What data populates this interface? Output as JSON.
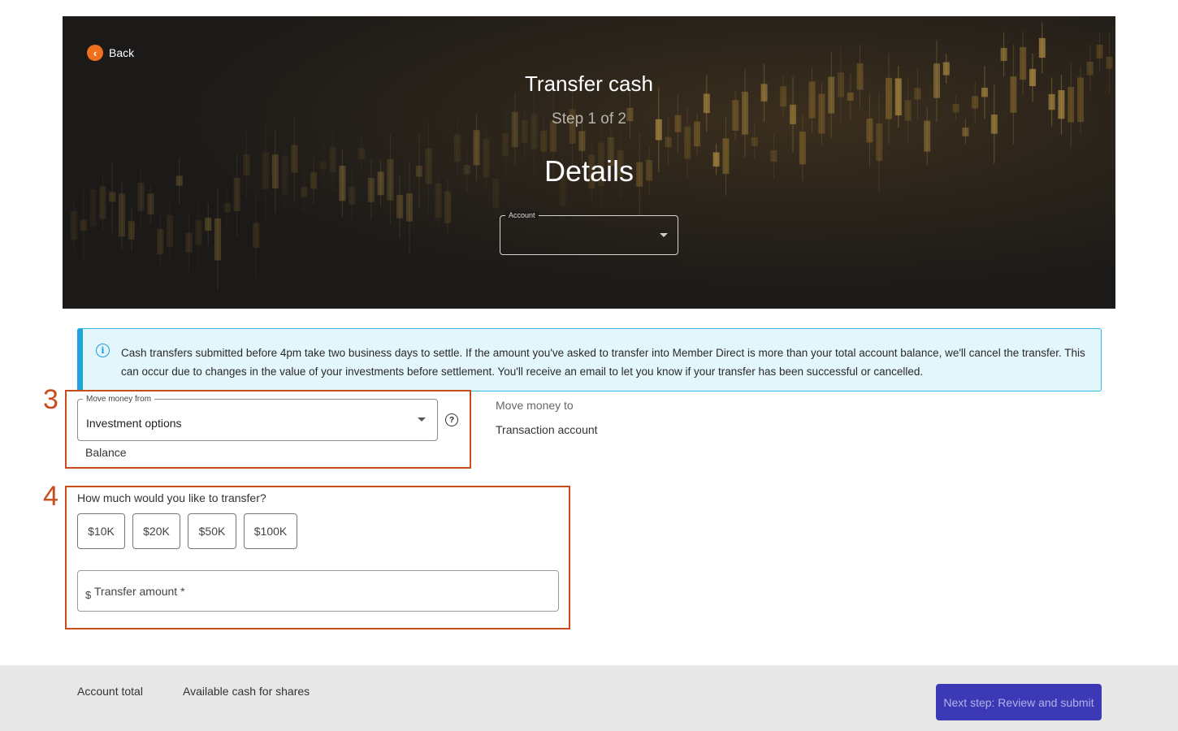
{
  "header": {
    "back_label": "Back",
    "title": "Transfer cash",
    "step": "Step 1 of 2",
    "heading": "Details",
    "account_legend": "Account",
    "account_value": ""
  },
  "info": {
    "text": "Cash transfers submitted before 4pm take two business days to settle. If the amount you've asked to transfer into Member Direct is more than your total account balance, we'll cancel the transfer. This can occur due to changes in the value of your investments before settlement. You'll receive an email to let you know if your transfer has been successful or cancelled."
  },
  "annotations": [
    "3",
    "4"
  ],
  "move_from": {
    "legend": "Move money from",
    "value": "Investment options",
    "balance_label": "Balance"
  },
  "move_to": {
    "label": "Move money to",
    "value": "Transaction account"
  },
  "amount": {
    "question": "How much would you like to transfer?",
    "chips": [
      "$10K",
      "$20K",
      "$50K",
      "$100K"
    ],
    "currency": "$",
    "placeholder": "Transfer amount *"
  },
  "footer": {
    "account_total_label": "Account total",
    "available_cash_label": "Available cash for shares",
    "next_button": "Next step: Review and submit"
  },
  "colors": {
    "accent_orange": "#ee6f1c",
    "annotation_red": "#c94d1c",
    "info_blue": "#1fa3da",
    "button_primary": "#3b39b6"
  }
}
